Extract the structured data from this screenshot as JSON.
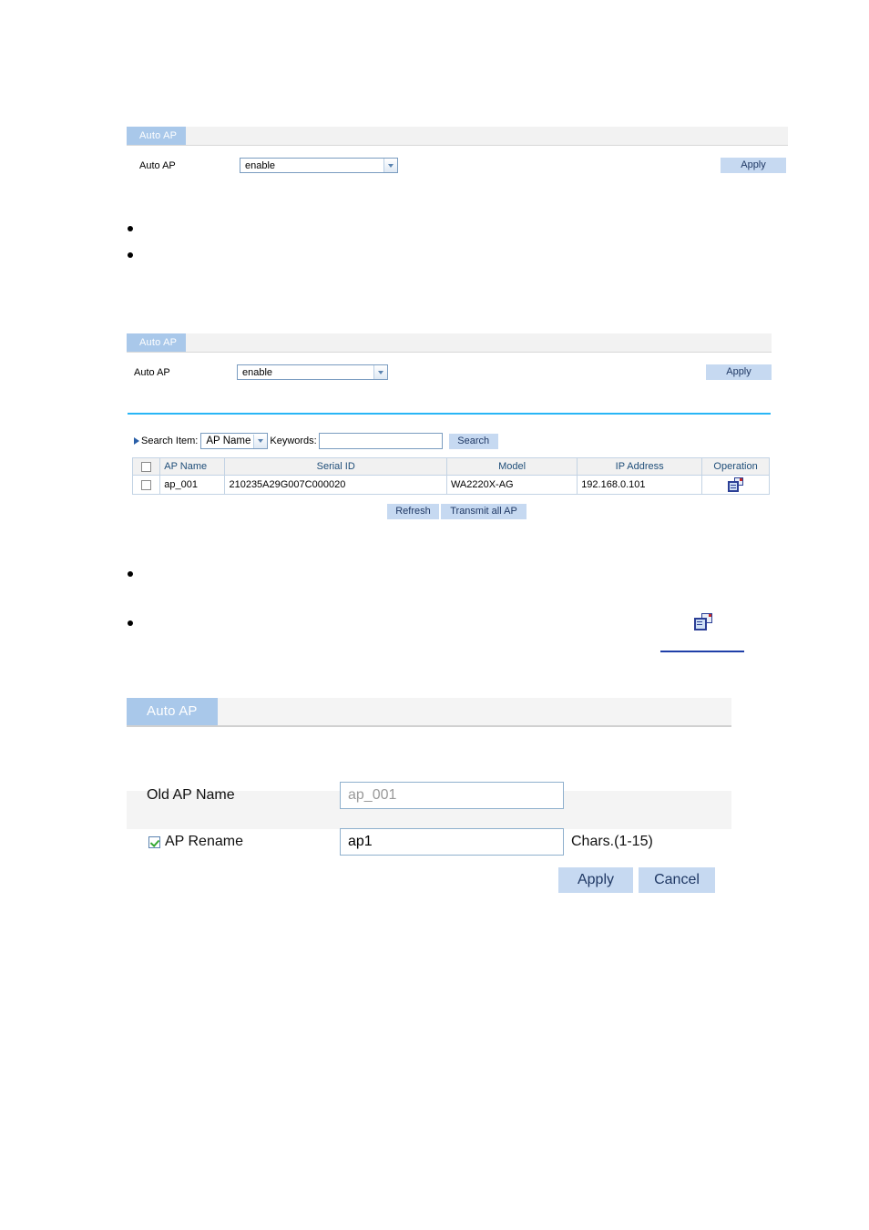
{
  "panel1": {
    "tab_label": "Auto AP",
    "auto_ap_label": "Auto AP",
    "auto_ap_value": "enable",
    "apply_label": "Apply"
  },
  "bullets_group1": [
    "",
    ""
  ],
  "panel2": {
    "tab_label": "Auto AP",
    "auto_ap_label": "Auto AP",
    "auto_ap_value": "enable",
    "apply_label": "Apply",
    "search": {
      "search_item_label": "Search Item:",
      "search_item_value": "AP Name",
      "keywords_label": "Keywords:",
      "keywords_value": "",
      "search_button_label": "Search"
    },
    "table": {
      "headers": [
        "",
        "AP Name",
        "Serial ID",
        "Model",
        "IP Address",
        "Operation"
      ],
      "rows": [
        {
          "ap_name": "ap_001",
          "serial_id": "210235A29G007C000020",
          "model": "WA2220X-AG",
          "ip_address": "192.168.0.101",
          "operation_icon": "rename-icon"
        }
      ]
    },
    "refresh_label": "Refresh",
    "transmit_all_label": "Transmit all AP"
  },
  "bullets_group2": [
    "",
    ""
  ],
  "standalone_icon": "rename-icon",
  "panel3": {
    "tab_label": "Auto AP",
    "old_ap_name_label": "Old AP Name",
    "old_ap_name_value": "ap_001",
    "ap_rename_label": "AP Rename",
    "ap_rename_checked": true,
    "ap_rename_value": "ap1",
    "chars_hint": "Chars.(1-15)",
    "apply_label": "Apply",
    "cancel_label": "Cancel"
  },
  "colors": {
    "tab_blue": "#a9c8ea",
    "button_blue": "#c6d9f1",
    "divider_cyan": "#29b6f6",
    "link_blue": "#1f3fa8",
    "header_text": "#1f4e79"
  }
}
